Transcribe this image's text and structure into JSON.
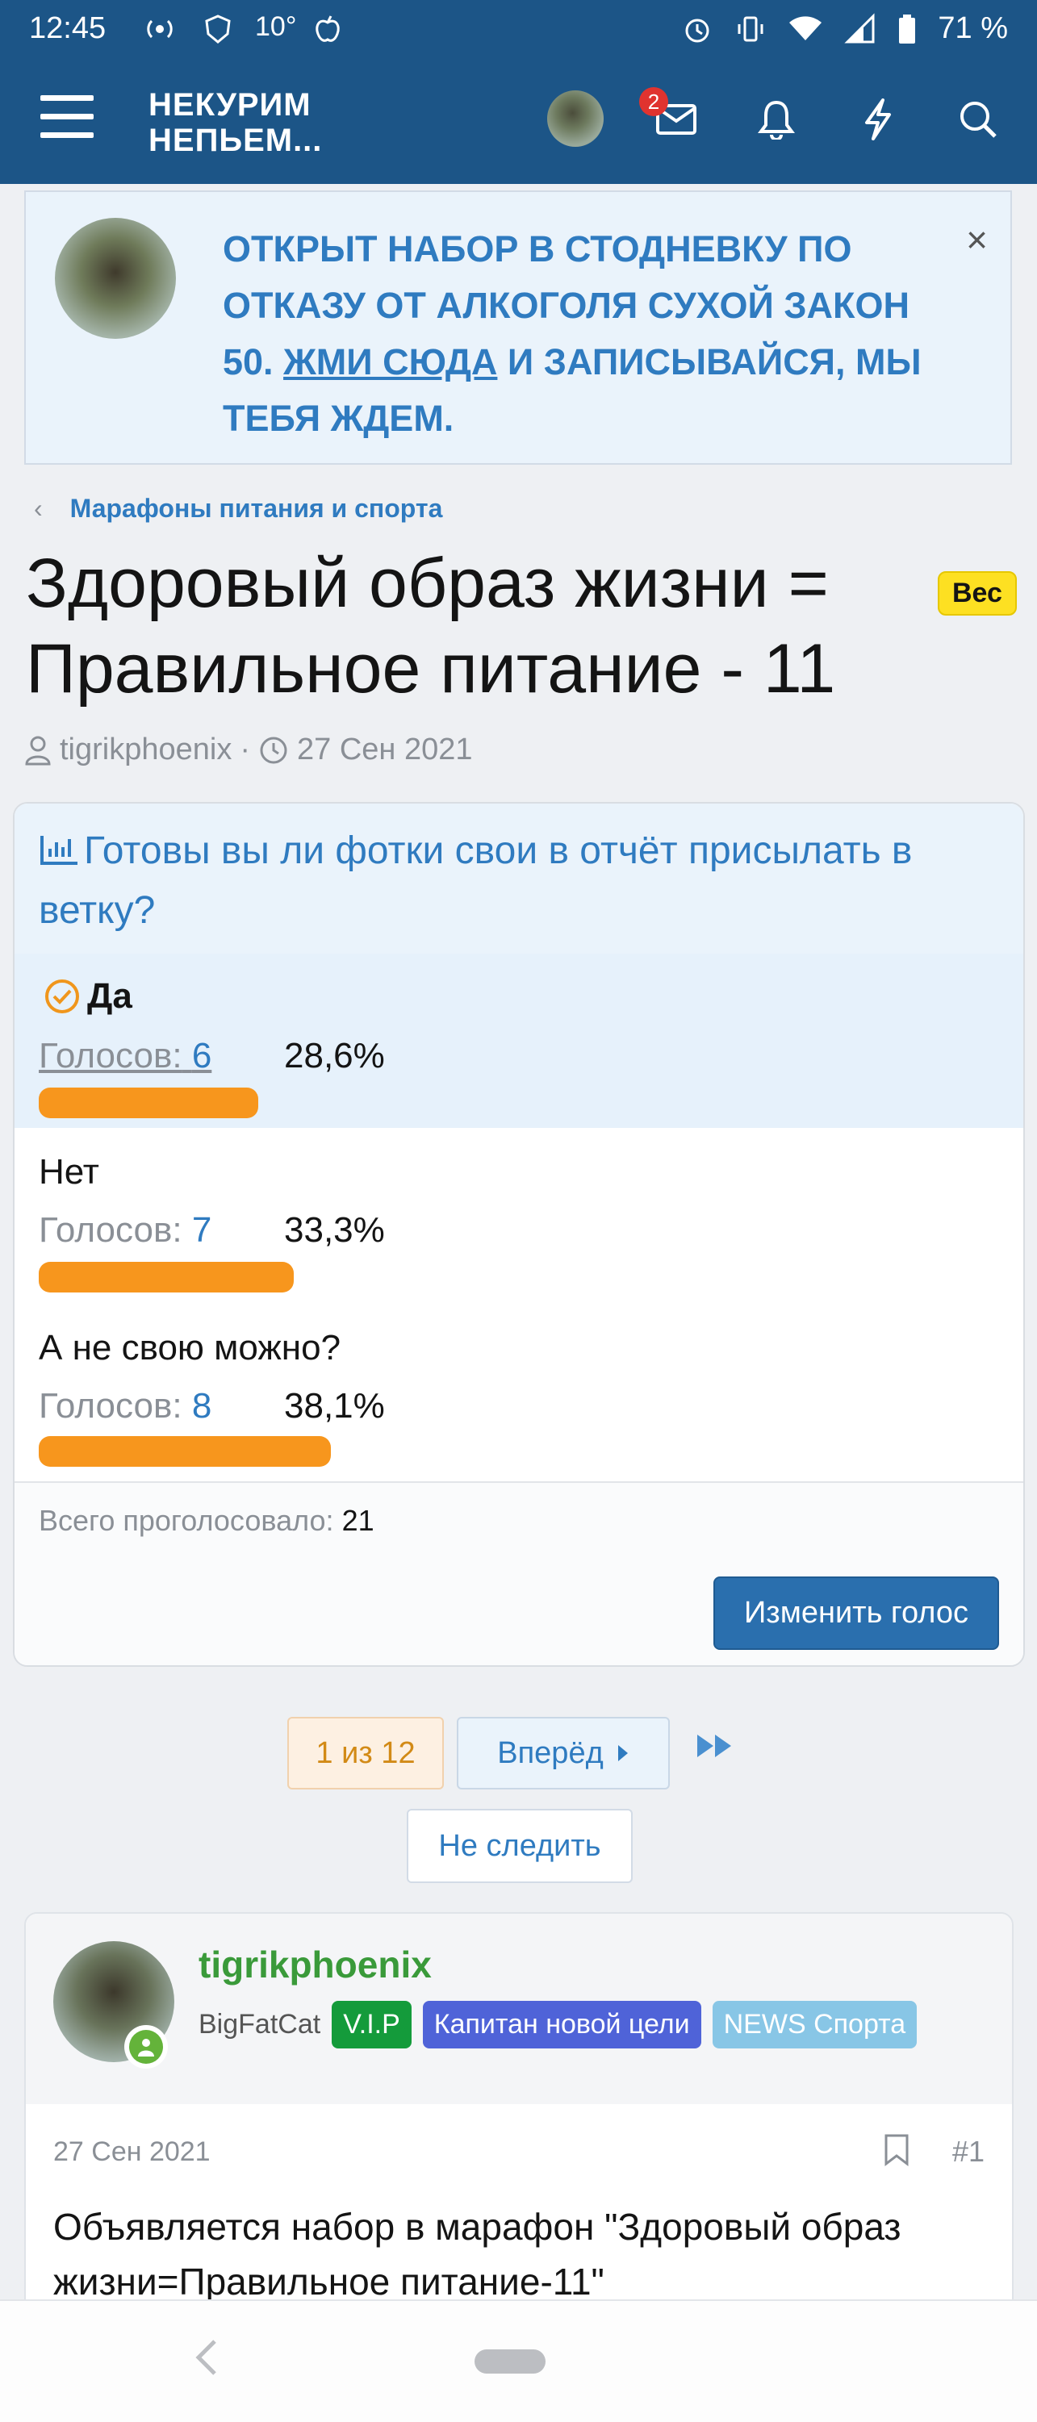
{
  "status_bar": {
    "time": "12:45",
    "temperature": "10°",
    "battery": "71 %",
    "icons_left": [
      "wireless-icon",
      "shield-icon",
      "weather-icon",
      "apple-icon"
    ],
    "icons_right": [
      "alarm-icon",
      "vibrate-icon",
      "wifi-icon",
      "signal-icon",
      "battery-icon"
    ]
  },
  "app_header": {
    "logo_line1": "НЕКУРИМ",
    "logo_line2": "НЕПЬЕМ...",
    "inbox_badge": "2"
  },
  "notice": {
    "text_before": "ОТКРЫТ НАБОР В СТОДНЕВКУ ПО ОТКАЗУ ОТ АЛКОГОЛЯ СУХОЙ ЗАКОН 50. ",
    "link_text": "ЖМИ СЮДА",
    "text_after": " И ЗАПИСЫВАЙСЯ, МЫ ТЕБЯ ЖДЕМ.",
    "close": "×"
  },
  "breadcrumb": {
    "chevron": "‹",
    "label": "Марафоны питания и спорта"
  },
  "thread": {
    "title": "Здоровый образ жизни = Правильное питание - 11",
    "tag": "Вес",
    "author": "tigrikphoenix",
    "separator": "·",
    "date": "27 Сен 2021"
  },
  "poll": {
    "question": "Готовы вы ли фотки свои в отчёт присылать в ветку?",
    "votes_label": "Голосов:",
    "options": [
      {
        "label": "Да",
        "votes": "6",
        "percent": "28,6%",
        "fraction": 0.286,
        "selected": true
      },
      {
        "label": "Нет",
        "votes": "7",
        "percent": "33,3%",
        "fraction": 0.333,
        "selected": false
      },
      {
        "label": "А не свою можно?",
        "votes": "8",
        "percent": "38,1%",
        "fraction": 0.381,
        "selected": false
      }
    ],
    "total_label": "Всего проголосовало:",
    "total_value": "21",
    "change_button": "Изменить голос"
  },
  "pagination": {
    "current": "1 из 12",
    "next": "Вперёд",
    "unwatch": "Не следить"
  },
  "post": {
    "username": "tigrikphoenix",
    "user_title": "BigFatCat",
    "badges": [
      "V.I.P",
      "Капитан новой цели",
      "NEWS Спорта"
    ],
    "date": "27 Сен 2021",
    "number": "#1",
    "body": "Объявляется набор в марафон \"Здоровый образ жизни=Правильное питание-11\""
  },
  "colors": {
    "header": "#1c5587",
    "link": "#2f7bc0",
    "bar": "#f7961d",
    "tag": "#fde022"
  }
}
